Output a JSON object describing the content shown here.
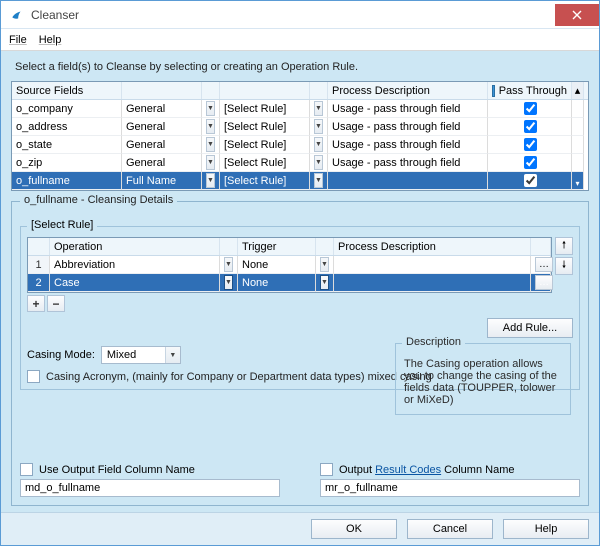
{
  "window": {
    "title": "Cleanser"
  },
  "menu": {
    "file": "File",
    "help": "Help"
  },
  "instruction": "Select a field(s) to Cleanse by selecting or creating an Operation Rule.",
  "grid_headers": {
    "source": "Source Fields",
    "process": "Process Description",
    "pass": "Pass Through"
  },
  "select_rule_label": "[Select Rule]",
  "source_rows": [
    {
      "name": "o_company",
      "type": "General",
      "rule": "[Select Rule]",
      "process": "Usage - pass through field",
      "pass": true,
      "selected": false
    },
    {
      "name": "o_address",
      "type": "General",
      "rule": "[Select Rule]",
      "process": "Usage - pass through field",
      "pass": true,
      "selected": false
    },
    {
      "name": "o_state",
      "type": "General",
      "rule": "[Select Rule]",
      "process": "Usage - pass through field",
      "pass": true,
      "selected": false
    },
    {
      "name": "o_zip",
      "type": "General",
      "rule": "[Select Rule]",
      "process": "Usage - pass through field",
      "pass": true,
      "selected": false
    },
    {
      "name": "o_fullname",
      "type": "Full Name",
      "rule": "[Select Rule]",
      "process": "",
      "pass": true,
      "selected": true
    }
  ],
  "details": {
    "title": "o_fullname - Cleansing Details",
    "rule_label": "[Select Rule]",
    "headers": {
      "operation": "Operation",
      "trigger": "Trigger",
      "process": "Process Description"
    },
    "rows": [
      {
        "num": "1",
        "op": "Abbreviation",
        "trigger": "None",
        "process": "",
        "selected": false
      },
      {
        "num": "2",
        "op": "Case",
        "trigger": "None",
        "process": "",
        "selected": true
      }
    ],
    "add_rule": "Add Rule...",
    "casing_mode_label": "Casing Mode:",
    "casing_mode_value": "Mixed",
    "acronym_label": "Casing Acronym, (mainly for Company or Department data types) mixed casing",
    "description_title": "Description",
    "description_text": "The Casing operation allows you to change the casing of the fields data (TOUPPER, tolower or MiXeD)"
  },
  "output": {
    "use_col_label": "Use Output Field Column Name",
    "use_col_value": "md_o_fullname",
    "result_pre": "Output ",
    "result_link": "Result Codes",
    "result_post": " Column Name",
    "result_value": "mr_o_fullname"
  },
  "buttons": {
    "ok": "OK",
    "cancel": "Cancel",
    "help": "Help"
  }
}
